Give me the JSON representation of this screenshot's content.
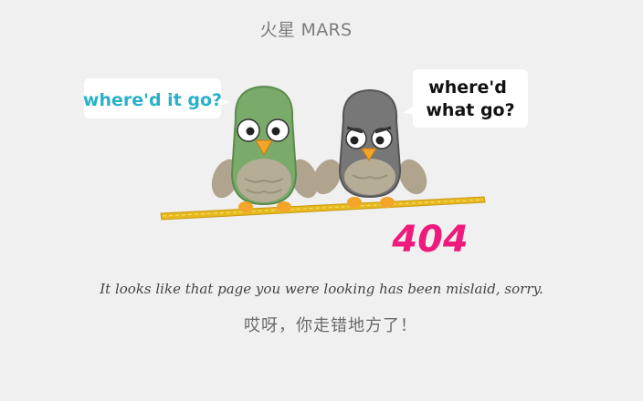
{
  "header": {
    "brand": "火星 MARS"
  },
  "illustration": {
    "bubble_left": "where'd it go?",
    "bubble_right_line1": "where'd",
    "bubble_right_line2": "what go?",
    "error_code": "404",
    "colors": {
      "left_bubble_text": "#2ab0c8",
      "right_bubble_text": "#111111",
      "error_code": "#ee1b7c",
      "left_bird": "#7aab6a",
      "right_bird": "#777777",
      "rope": "#e6b91e"
    }
  },
  "message": {
    "english": "It looks like that page you were looking has been mislaid, sorry.",
    "chinese": "哎呀，你走错地方了！"
  }
}
